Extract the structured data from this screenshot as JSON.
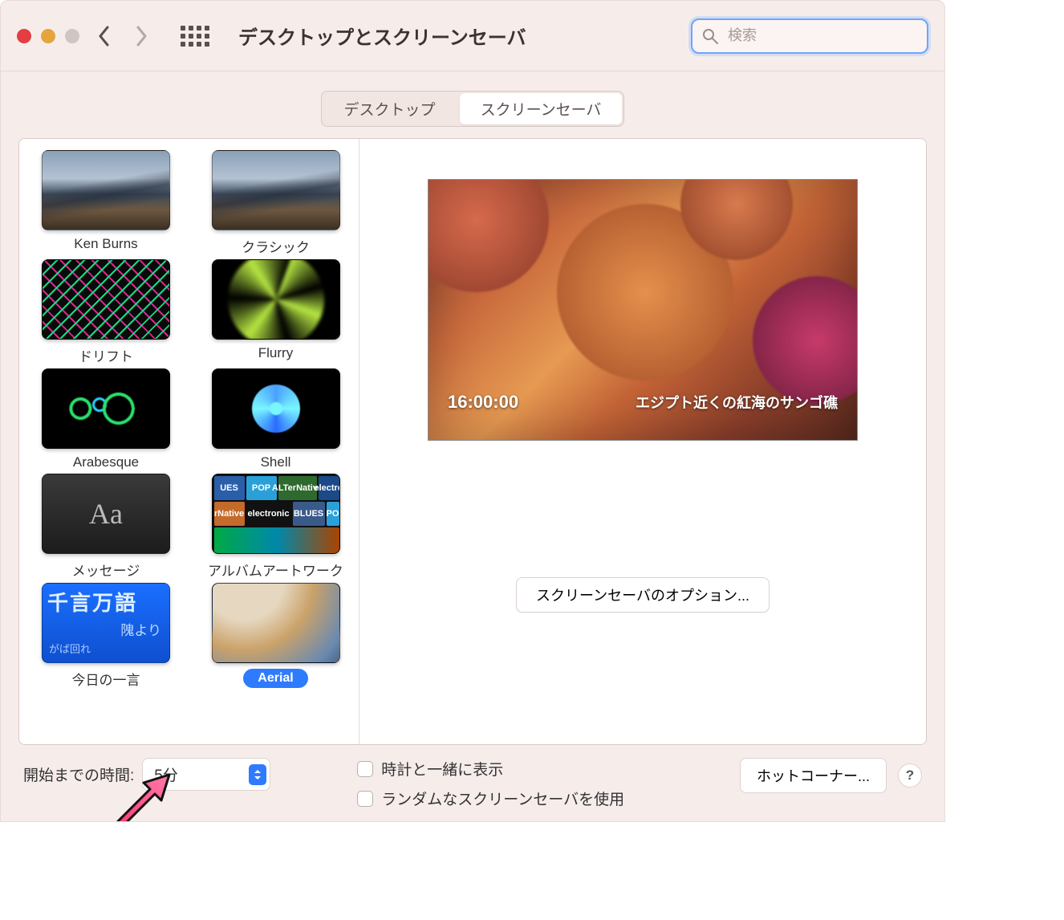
{
  "toolbar": {
    "title": "デスクトップとスクリーンセーバ",
    "search_placeholder": "検索"
  },
  "tabs": {
    "desktop": "デスクトップ",
    "screensaver": "スクリーンセーバ"
  },
  "savers": [
    {
      "id": "ken-burns",
      "label": "Ken Burns"
    },
    {
      "id": "classic",
      "label": "クラシック"
    },
    {
      "id": "drift",
      "label": "ドリフト"
    },
    {
      "id": "flurry",
      "label": "Flurry"
    },
    {
      "id": "arabesque",
      "label": "Arabesque"
    },
    {
      "id": "shell",
      "label": "Shell"
    },
    {
      "id": "message",
      "label": "メッセージ"
    },
    {
      "id": "album",
      "label": "アルバムアートワーク"
    },
    {
      "id": "quote",
      "label": "今日の一言"
    },
    {
      "id": "aerial",
      "label": "Aerial",
      "selected": true
    }
  ],
  "preview": {
    "time": "16:00:00",
    "location": "エジプト近くの紅海のサンゴ礁",
    "options_button": "スクリーンセーバのオプション..."
  },
  "bottom": {
    "start_label": "開始までの時間:",
    "start_value": "5分",
    "check_clock": "時計と一緒に表示",
    "check_random": "ランダムなスクリーンセーバを使用",
    "hot_corners": "ホットコーナー...",
    "help": "?"
  },
  "glyphs": {
    "message_thumb": "Aa",
    "quote_big": "千言万語",
    "quote_mid": "隗より",
    "quote_sm": "がば回れ",
    "album_tiles": [
      "UES",
      "POP",
      "ALTerNative",
      "electro",
      "rNative",
      "electronic",
      "BLUES",
      "PO"
    ]
  }
}
